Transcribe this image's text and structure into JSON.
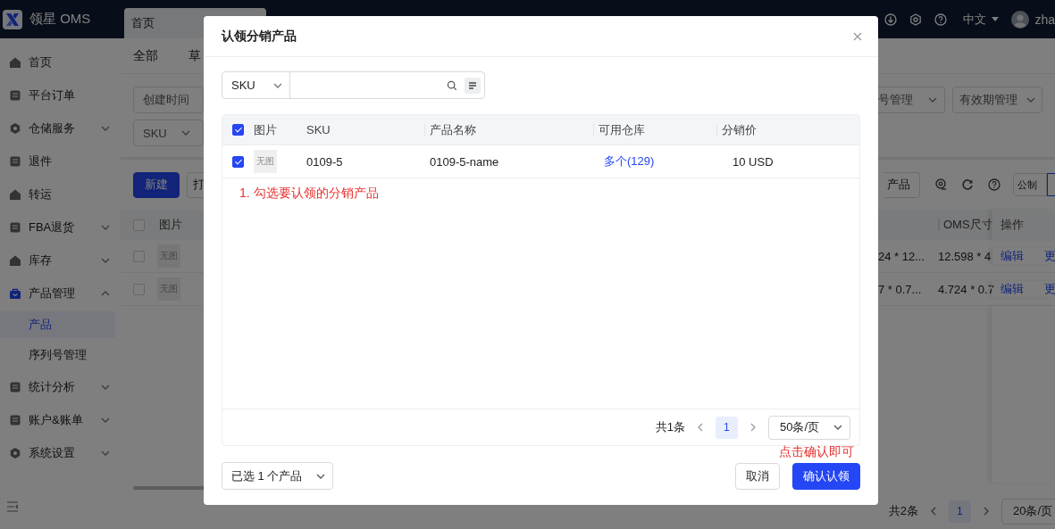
{
  "app": {
    "logo_text": "领星 OMS",
    "tabs": [
      {
        "label": "首页",
        "selected": true
      }
    ],
    "language": "中文",
    "user": "zha"
  },
  "sidebar": {
    "items": [
      {
        "label": "首页",
        "selected": false
      },
      {
        "label": "平台订单",
        "selected": false
      },
      {
        "label": "仓储服务",
        "selected": false,
        "expanded": false
      },
      {
        "label": "退件",
        "selected": false
      },
      {
        "label": "转运",
        "selected": false
      },
      {
        "label": "FBA退货",
        "selected": false,
        "expanded": false
      },
      {
        "label": "库存",
        "selected": false,
        "expanded": false
      },
      {
        "label": "产品管理",
        "selected": false,
        "expanded": true,
        "children": [
          {
            "label": "产品",
            "selected": true
          },
          {
            "label": "序列号管理",
            "selected": false
          }
        ]
      },
      {
        "label": "统计分析",
        "selected": false,
        "expanded": false
      },
      {
        "label": "账户&账单",
        "selected": false,
        "expanded": false
      },
      {
        "label": "系统设置",
        "selected": false,
        "expanded": false
      }
    ]
  },
  "main": {
    "status_tabs": [
      "全部",
      "草"
    ],
    "filters_left": [
      {
        "label": "创建时间",
        "kind": "plain"
      },
      {
        "label": "SKU",
        "kind": "select"
      }
    ],
    "filters_right": [
      {
        "label": "号管理",
        "kind": "select"
      },
      {
        "label": "有效期管理",
        "kind": "select"
      }
    ],
    "toolbar_left": [
      {
        "label": "新建",
        "kind": "primary"
      },
      {
        "label": "打",
        "kind": "default"
      }
    ],
    "toolbar_right": [
      {
        "label": "产品",
        "kind": "default"
      },
      {
        "label": "公制",
        "kind": "toggle"
      }
    ],
    "table": {
      "all_checked": false,
      "columns_left": [
        "图片"
      ],
      "columns_right": [
        "OMS尺寸",
        "操作"
      ],
      "rows": [
        {
          "checked": false,
          "image": "无图",
          "column_3": "24 * 12...",
          "oms_size": "12.598 * 4",
          "actions": [
            "编辑",
            "更"
          ]
        },
        {
          "checked": false,
          "image": "无图",
          "column_3": "7 * 0.7...",
          "oms_size": "4.724 * 0.7",
          "actions": [
            "编辑",
            "更"
          ]
        }
      ]
    },
    "pagination": {
      "total": "共2条",
      "pages": [
        {
          "label": "1",
          "selected": true
        }
      ],
      "page_size": "20条/页"
    }
  },
  "dialog": {
    "title": "认领分销产品",
    "search": {
      "field": "SKU"
    },
    "table": {
      "all_checked": true,
      "columns": [
        "图片",
        "SKU",
        "产品名称",
        "可用仓库",
        "分销价"
      ],
      "rows": [
        {
          "checked": true,
          "image": "无图",
          "sku": "0109-5",
          "name": "0109-5-name",
          "warehouse": "多个(129)",
          "price": "10 USD"
        }
      ]
    },
    "annotation": "1. 勾选要认领的分销产品",
    "pagination": {
      "total": "共1条",
      "pages": [
        {
          "label": "1",
          "selected": true
        }
      ],
      "page_size": "50条/页"
    },
    "selected_summary": "已选 1 个产品",
    "hint": "点击确认即可",
    "buttons": [
      {
        "label": "取消",
        "kind": "default"
      },
      {
        "label": "确认认领",
        "kind": "primary"
      }
    ]
  }
}
